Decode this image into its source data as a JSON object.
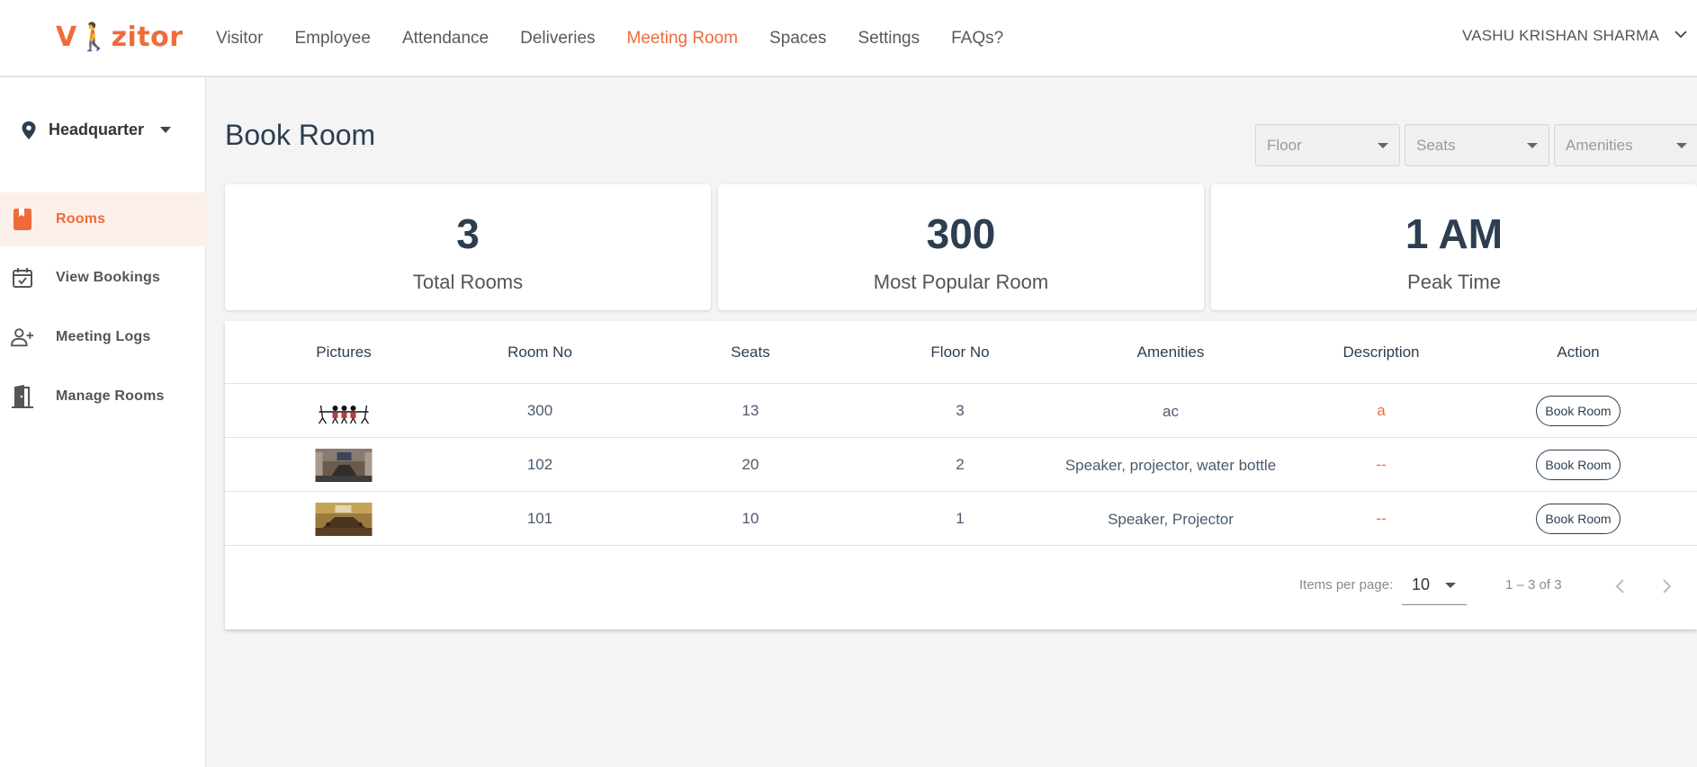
{
  "brand": {
    "logo_prefix": "V",
    "logo_mark": "Ὣ6",
    "logo_suffix": "zitor"
  },
  "nav": {
    "items": [
      {
        "label": "Visitor"
      },
      {
        "label": "Employee"
      },
      {
        "label": "Attendance"
      },
      {
        "label": "Deliveries"
      },
      {
        "label": "Meeting Room"
      },
      {
        "label": "Spaces"
      },
      {
        "label": "Settings"
      },
      {
        "label": "FAQs?"
      }
    ],
    "active": "Meeting Room"
  },
  "user": {
    "name": "VASHU KRISHAN SHARMA"
  },
  "sidebar": {
    "location": "Headquarter",
    "items": [
      {
        "label": "Rooms",
        "icon": "book-icon"
      },
      {
        "label": "View Bookings",
        "icon": "calendar-check-icon"
      },
      {
        "label": "Meeting Logs",
        "icon": "person-add-icon"
      },
      {
        "label": "Manage Rooms",
        "icon": "door-icon"
      }
    ]
  },
  "page": {
    "title": "Book Room"
  },
  "filters": {
    "floor": "Floor",
    "seats": "Seats",
    "amenities": "Amenities"
  },
  "stats": [
    {
      "value": "3",
      "label": "Total Rooms"
    },
    {
      "value": "300",
      "label": "Most Popular Room"
    },
    {
      "value": "1 AM",
      "label": "Peak Time"
    }
  ],
  "table": {
    "headers": [
      "Pictures",
      "Room No",
      "Seats",
      "Floor No",
      "Amenities",
      "Description",
      "Action"
    ],
    "rows": [
      {
        "room_no": "300",
        "seats": "13",
        "floor": "3",
        "amenities": "ac",
        "description": "a",
        "action": "Book Room",
        "picture": "chairs-illustration"
      },
      {
        "room_no": "102",
        "seats": "20",
        "floor": "2",
        "amenities": "Speaker, projector, water bottle",
        "description": "--",
        "action": "Book Room",
        "picture": "conference-room-photo"
      },
      {
        "room_no": "101",
        "seats": "10",
        "floor": "1",
        "amenities": "Speaker, Projector",
        "description": "--",
        "action": "Book Room",
        "picture": "boardroom-photo"
      }
    ]
  },
  "pagination": {
    "items_per_page_label": "Items per page:",
    "items_per_page": "10",
    "range": "1 – 3 of 3"
  },
  "colors": {
    "accent": "#ef6b3a",
    "text_dark": "#2c3e50",
    "sidebar_active_bg": "#fdf0eb"
  }
}
